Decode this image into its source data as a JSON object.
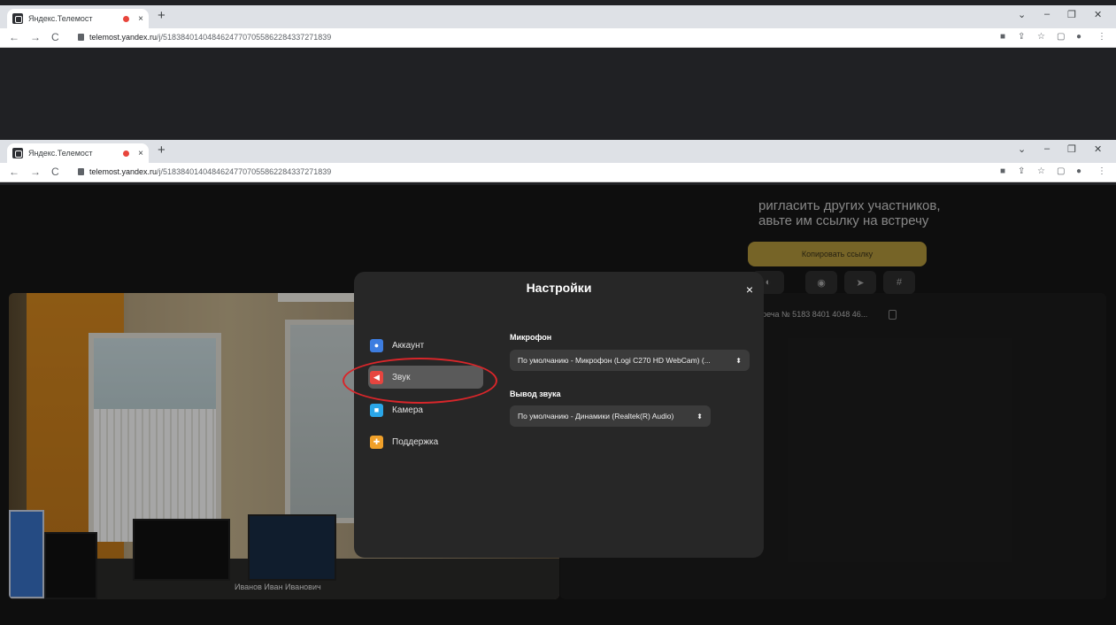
{
  "browser": {
    "tab_title": "Яндекс.Телемост",
    "tab_close": "×",
    "new_tab": "+",
    "url_host": "telemost.yandex.ru",
    "url_path": "/j/51838401404846247707055862284337271839",
    "window_controls": [
      "⌄",
      "–",
      "❐",
      "✕"
    ]
  },
  "video": {
    "participant_name": "Иванов Иван Иванович"
  },
  "invite": {
    "line1": "ригласить других участников,",
    "line2": "авьте им ссылку на встречу",
    "copy_button": "Копировать ссылку",
    "share_icons": [
      "telegram-icon",
      "whatsapp-icon",
      "send-icon",
      "slack-icon"
    ],
    "meeting_number": "треча № 5183 8401 4048 46..."
  },
  "settings": {
    "title": "Настройки",
    "close": "×",
    "menu": [
      {
        "label": "Аккаунт",
        "icon": "account-icon",
        "color": "#3d7de0"
      },
      {
        "label": "Звук",
        "icon": "sound-icon",
        "color": "#e6453f",
        "active": true
      },
      {
        "label": "Камера",
        "icon": "camera-icon",
        "color": "#2aa6e8"
      },
      {
        "label": "Поддержка",
        "icon": "support-icon",
        "color": "#f0a02a"
      }
    ],
    "mic_label": "Микрофон",
    "mic_value": "По умолчанию - Микрофон (Logi C270 HD WebCam) (...",
    "output_label": "Вывод звука",
    "output_value": "По умолчанию - Динамики (Realtek(R) Audio)"
  },
  "annotation": {
    "color": "#d8262a"
  }
}
